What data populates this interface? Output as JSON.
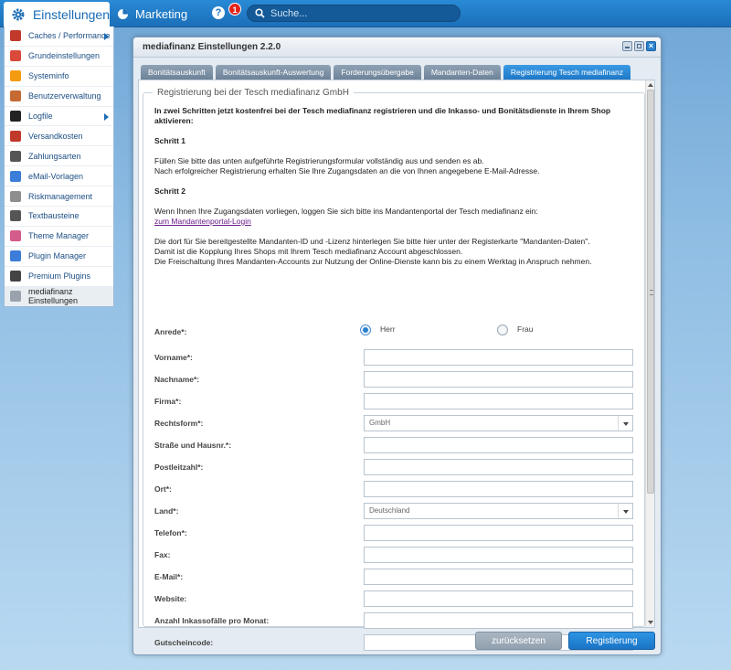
{
  "topbar": {
    "settings_label": "Einstellungen",
    "marketing_label": "Marketing",
    "help_icon": "?",
    "notification_count": "1",
    "search_placeholder": "Suche..."
  },
  "sidebar": {
    "items": [
      {
        "label": "Caches / Performance",
        "icon": "speedometer-icon",
        "color": "#c0392b",
        "submenu": true
      },
      {
        "label": "Grundeinstellungen",
        "icon": "wrench-icon",
        "color": "#d94a3a",
        "submenu": false
      },
      {
        "label": "Systeminfo",
        "icon": "lightning-icon",
        "color": "#f39c12",
        "submenu": false
      },
      {
        "label": "Benutzerverwaltung",
        "icon": "user-icon",
        "color": "#c46a32",
        "submenu": false
      },
      {
        "label": "Logfile",
        "icon": "terminal-icon",
        "color": "#222222",
        "submenu": true
      },
      {
        "label": "Versandkosten",
        "icon": "truck-icon",
        "color": "#c0392b",
        "submenu": false
      },
      {
        "label": "Zahlungsarten",
        "icon": "creditcard-icon",
        "color": "#555555",
        "submenu": false
      },
      {
        "label": "eMail-Vorlagen",
        "icon": "mail-icon",
        "color": "#3b7dd8",
        "submenu": false
      },
      {
        "label": "Riskmanagement",
        "icon": "trophy-icon",
        "color": "#8e8e8e",
        "submenu": false
      },
      {
        "label": "Textbausteine",
        "icon": "abc-icon",
        "color": "#555555",
        "submenu": false
      },
      {
        "label": "Theme Manager",
        "icon": "palette-icon",
        "color": "#d35c8b",
        "submenu": false
      },
      {
        "label": "Plugin Manager",
        "icon": "puzzle-icon",
        "color": "#3b7dd8",
        "submenu": false
      },
      {
        "label": "Premium Plugins",
        "icon": "shopware-icon",
        "color": "#444444",
        "submenu": false
      },
      {
        "label": "mediafinanz Einstellungen",
        "icon": "gear-icon",
        "color": "#9aa3ad",
        "submenu": false
      }
    ]
  },
  "window": {
    "title": "mediafinanz Einstellungen 2.2.0",
    "tabs": [
      {
        "label": "Bonitätsauskunft"
      },
      {
        "label": "Bonitätsauskunft-Auswertung"
      },
      {
        "label": "Forderungsübergabe"
      },
      {
        "label": "Mandanten-Daten"
      },
      {
        "label": "Registrierung Tesch mediafinanz"
      }
    ],
    "fieldset_legend": "Registrierung bei der Tesch mediafinanz GmbH",
    "intro_bold": "In zwei Schritten jetzt kostenfrei bei der Tesch mediafinanz registrieren und die Inkasso- und Bonitätsdienste in Ihrem Shop aktivieren:",
    "step1_title": "Schritt 1",
    "step1_line1": "Füllen Sie bitte das unten aufgeführte Registrierungsformular vollständig aus und senden es ab.",
    "step1_line2": "Nach erfolgreicher Registrierung erhalten Sie Ihre Zugangsdaten an die von Ihnen angegebene E-Mail-Adresse.",
    "step2_title": "Schritt 2",
    "step2_line1": "Wenn Ihnen Ihre Zugangsdaten vorliegen, loggen Sie sich bitte ins Mandantenportal der Tesch mediafinanz ein:",
    "step2_link": "zum Mandantenportal-Login",
    "info_line1": "Die dort für Sie bereitgestellte Mandanten-ID und -Lizenz hinterlegen Sie bitte hier unter der Registerkarte \"Mandanten-Daten\".",
    "info_line2": "Damit ist die Kopplung Ihres Shops mit Ihrem Tesch mediafinanz Account abgeschlossen.",
    "info_line3": "Die Freischaltung Ihres Mandanten-Accounts zur Nutzung der Online-Dienste kann bis zu einem Werktag in Anspruch nehmen.",
    "form": {
      "salutation_label": "Anrede*:",
      "salutation_option_1": "Herr",
      "salutation_option_2": "Frau",
      "fields": [
        {
          "label": "Vorname*:",
          "type": "text",
          "value": ""
        },
        {
          "label": "Nachname*:",
          "type": "text",
          "value": ""
        },
        {
          "label": "Firma*:",
          "type": "text",
          "value": ""
        },
        {
          "label": "Rechtsform*:",
          "type": "select",
          "value": "GmbH"
        },
        {
          "label": "Straße und Hausnr.*:",
          "type": "text",
          "value": ""
        },
        {
          "label": "Postleitzahl*:",
          "type": "text",
          "value": ""
        },
        {
          "label": "Ort*:",
          "type": "text",
          "value": ""
        },
        {
          "label": "Land*:",
          "type": "select",
          "value": "Deutschland"
        },
        {
          "label": "Telefon*:",
          "type": "text",
          "value": ""
        },
        {
          "label": "Fax:",
          "type": "text",
          "value": ""
        },
        {
          "label": "E-Mail*:",
          "type": "text",
          "value": ""
        },
        {
          "label": "Website:",
          "type": "text",
          "value": ""
        },
        {
          "label": "Anzahl Inkassofälle pro Monat:",
          "type": "text",
          "value": ""
        },
        {
          "label": "Gutscheincode:",
          "type": "text",
          "value": ""
        }
      ]
    },
    "buttons": {
      "reset": "zurücksetzen",
      "submit": "Registierung"
    }
  }
}
